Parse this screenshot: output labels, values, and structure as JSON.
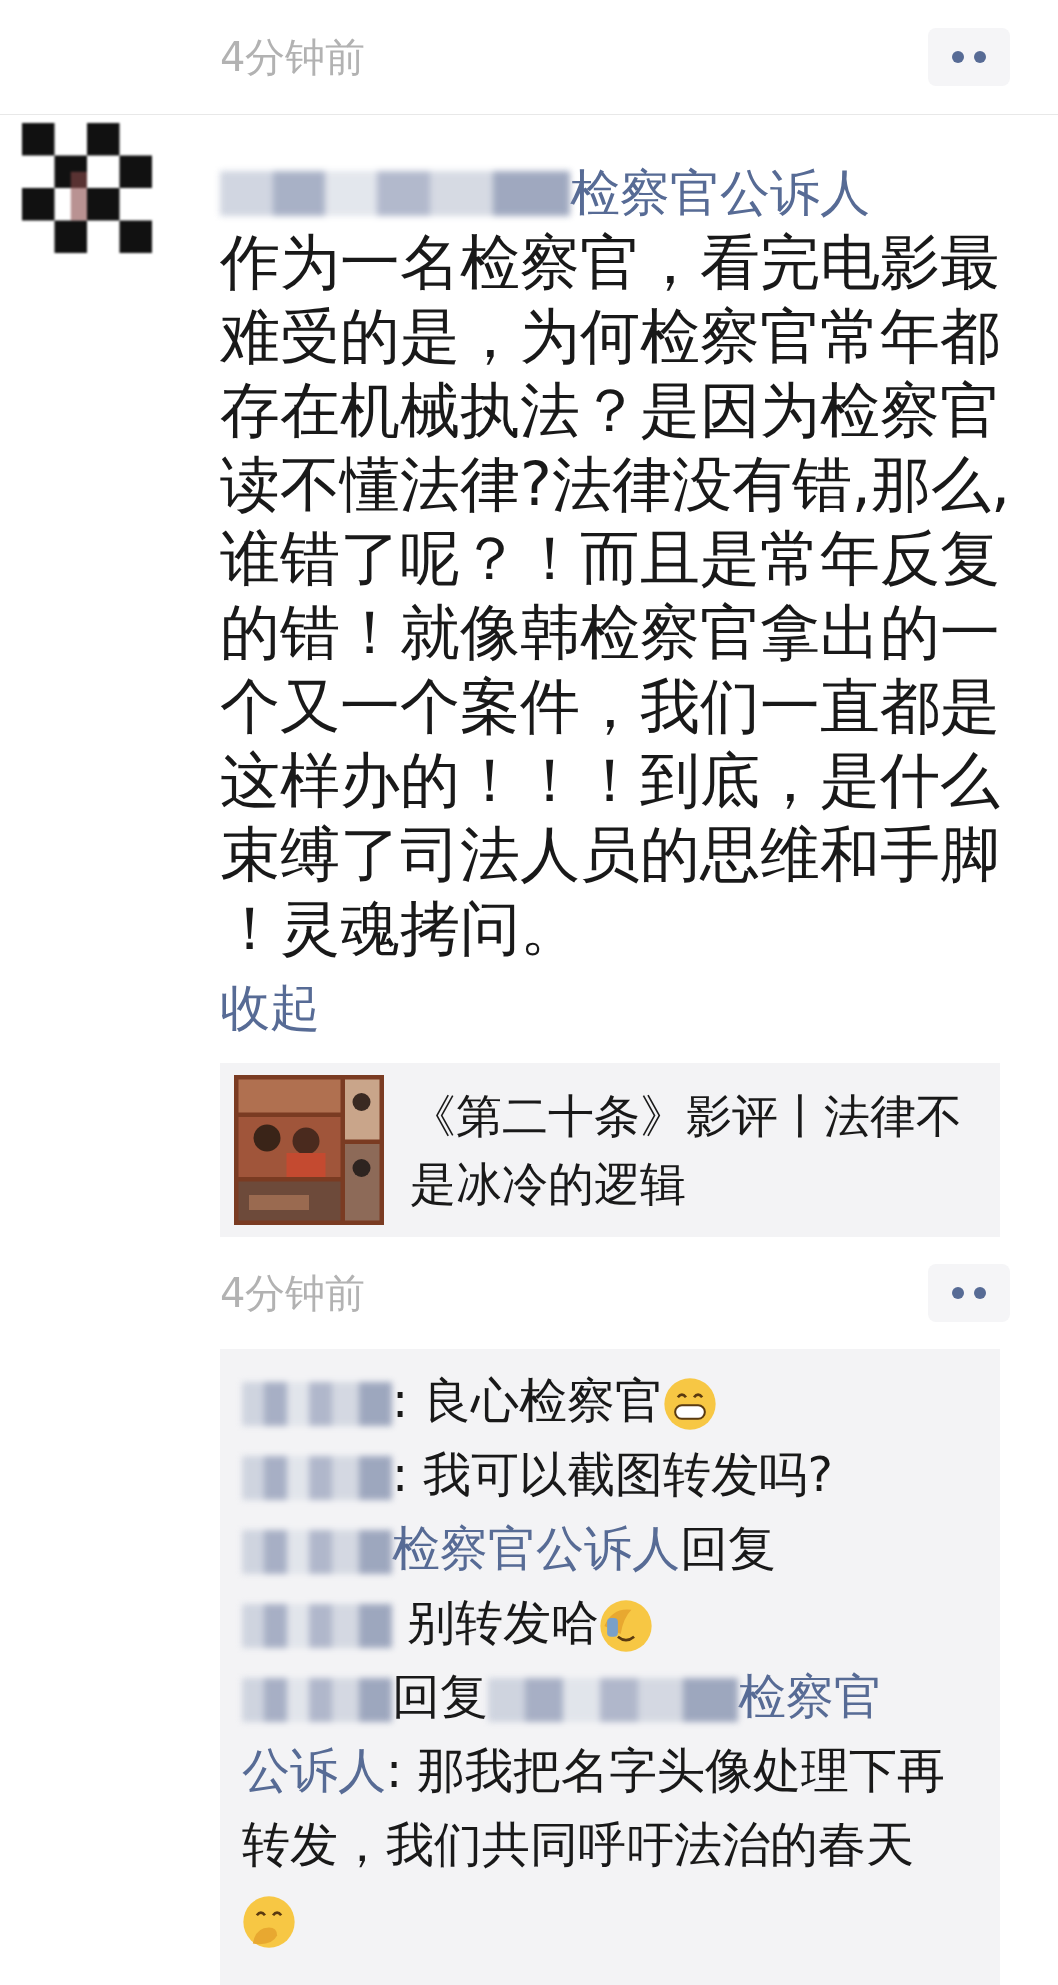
{
  "previous_post": {
    "time": "4分钟前"
  },
  "post": {
    "author": {
      "name": "检察官公诉人"
    },
    "text": "作为一名检察官，看完电影最难受的是，为何检察官常年都存在机械执法？是因为检察官读不懂法律?法律没有错,那么,谁错了呢？！而且是常年反复的错！就像韩检察官拿出的一个又一个案件，我们一直都是这样办的！！！到底，是什么束缚了司法人员的思维和手脚！灵魂拷问。",
    "collapse_link": "收起",
    "link_card": {
      "title": "《第二十条》影评丨法律不是冰冷的逻辑"
    },
    "time": "4分钟前",
    "comments": [
      {
        "lines": [
          [
            {
              "kind": "blur"
            },
            {
              "kind": "text",
              "text": ": 良心检察官"
            },
            {
              "kind": "grin"
            }
          ]
        ]
      },
      {
        "lines": [
          [
            {
              "kind": "blur"
            },
            {
              "kind": "text",
              "text": ": 我可以截图转发吗?"
            }
          ]
        ]
      },
      {
        "lines": [
          [
            {
              "kind": "blur"
            },
            {
              "kind": "name",
              "text": "检察官公诉人"
            },
            {
              "kind": "text",
              "text": "回复"
            }
          ],
          [
            {
              "kind": "blur"
            },
            {
              "kind": "text",
              "text": " 别转发哈"
            },
            {
              "kind": "facepalm"
            }
          ]
        ]
      },
      {
        "lines": [
          [
            {
              "kind": "blur"
            },
            {
              "kind": "text",
              "text": "回复"
            },
            {
              "kind": "blur"
            },
            {
              "kind": "name",
              "text": "检察官"
            }
          ],
          [
            {
              "kind": "name",
              "text": "公诉人"
            },
            {
              "kind": "text",
              "text": ": 那我把名字头像处理下再"
            }
          ],
          [
            {
              "kind": "text",
              "text": "转发，我们共同呼吁法治的春天"
            }
          ],
          [
            {
              "kind": "giggle"
            }
          ]
        ]
      }
    ]
  }
}
